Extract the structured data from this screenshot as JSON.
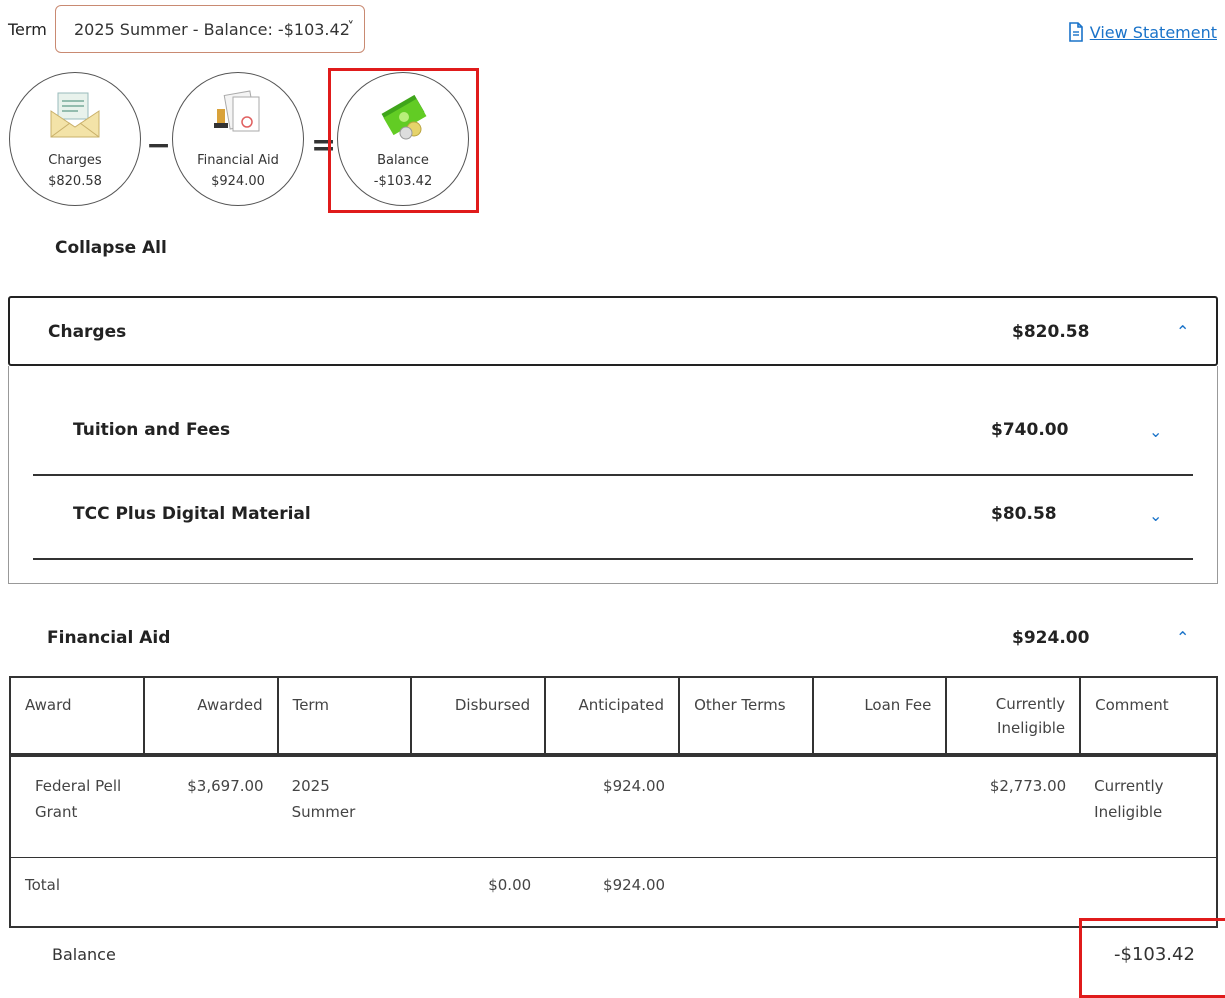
{
  "term": {
    "label": "Term",
    "selected": "2025 Summer - Balance: -$103.42"
  },
  "view_statement": "View Statement",
  "summary": {
    "charges": {
      "label": "Charges",
      "amount": "$820.58"
    },
    "minus": "−",
    "financial_aid": {
      "label": "Financial Aid",
      "amount": "$924.00"
    },
    "equals": "=",
    "balance": {
      "label": "Balance",
      "amount": "-$103.42"
    }
  },
  "collapse_all": "Collapse All",
  "charges": {
    "title": "Charges",
    "amount": "$820.58",
    "items": [
      {
        "label": "Tuition and Fees",
        "amount": "$740.00"
      },
      {
        "label": "TCC Plus Digital Material",
        "amount": "$80.58"
      }
    ]
  },
  "financial_aid": {
    "title": "Financial Aid",
    "amount": "$924.00",
    "columns": [
      "Award",
      "Awarded",
      "Term",
      "Disbursed",
      "Anticipated",
      "Other Terms",
      "Loan Fee",
      "Currently Ineligible",
      "Comment"
    ],
    "rows": [
      {
        "award": "Federal Pell Grant",
        "awarded": "$3,697.00",
        "term": "2025 Summer",
        "disbursed": "",
        "anticipated": "$924.00",
        "other_terms": "",
        "loan_fee": "",
        "currently_ineligible": "$2,773.00",
        "comment": "Currently Ineligible"
      }
    ],
    "total": {
      "label": "Total",
      "disbursed": "$0.00",
      "anticipated": "$924.00"
    }
  },
  "balance": {
    "label": "Balance",
    "amount": "-$103.42"
  },
  "colors": {
    "accent": "#1a73c9",
    "highlight": "#e01b1b",
    "money_green": "#5cc21f"
  }
}
